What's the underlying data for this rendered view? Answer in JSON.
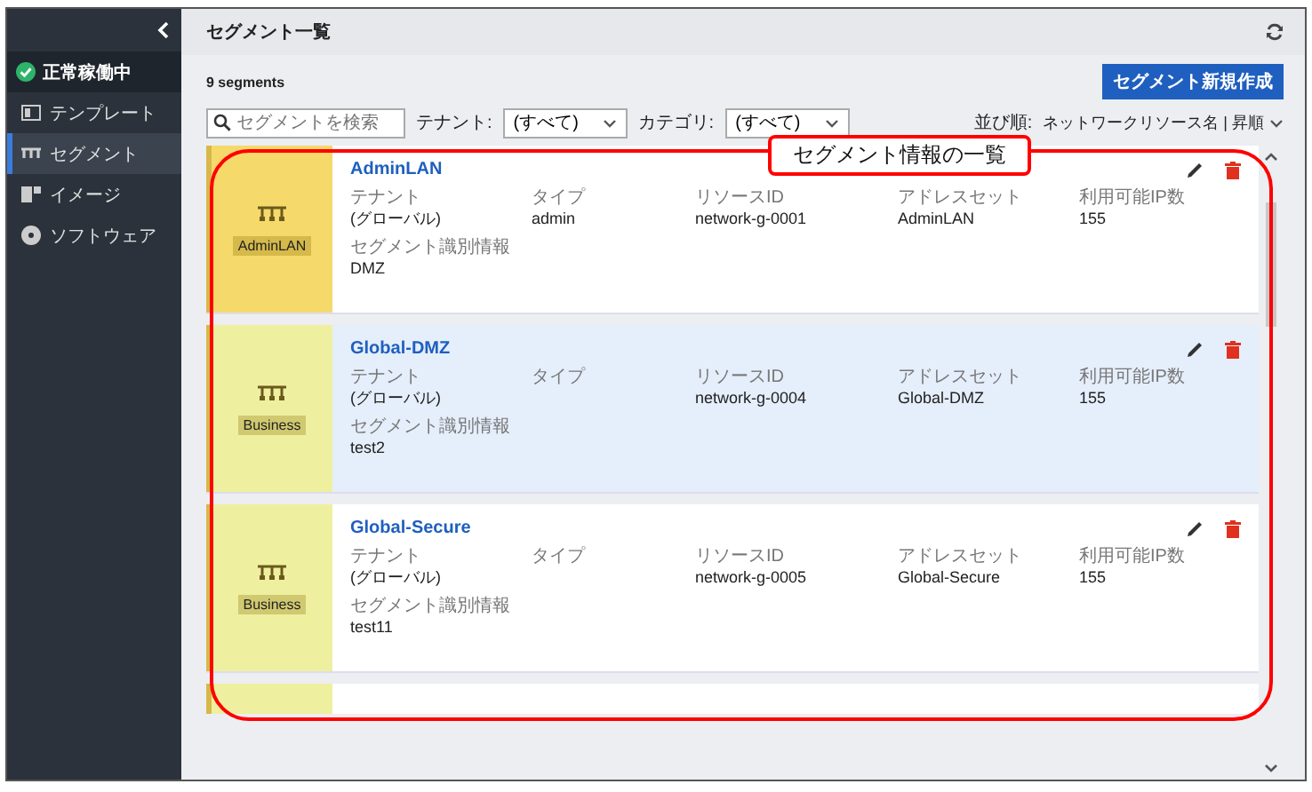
{
  "sidebar": {
    "status": "正常稼働中",
    "items": [
      {
        "label": "テンプレート",
        "selected": false
      },
      {
        "label": "セグメント",
        "selected": true
      },
      {
        "label": "イメージ",
        "selected": false
      },
      {
        "label": "ソフトウェア",
        "selected": false
      }
    ]
  },
  "header": {
    "title": "セグメント一覧"
  },
  "count": "9 segments",
  "create_button": "セグメント新規作成",
  "search": {
    "placeholder": "セグメントを検索"
  },
  "filters": [
    {
      "label": "テナント:",
      "value": "(すべて)"
    },
    {
      "label": "カテゴリ:",
      "value": "(すべて)"
    }
  ],
  "sort": {
    "label": "並び順:",
    "value": "ネットワークリソース名 | 昇順"
  },
  "segments": [
    {
      "name": "AdminLAN",
      "category": "AdminLAN",
      "color": "#f5d96b",
      "highlighted": false,
      "fields": [
        {
          "label": "テナント",
          "value": "(グローバル)"
        },
        {
          "label": "タイプ",
          "value": "admin"
        },
        {
          "label": "リソースID",
          "value": "network-g-0001"
        },
        {
          "label": "アドレスセット",
          "value": "AdminLAN"
        },
        {
          "label": "利用可能IP数",
          "value": "155"
        }
      ],
      "id_label": "セグメント識別情報",
      "id_value": "DMZ"
    },
    {
      "name": "Global-DMZ",
      "category": "Business",
      "color": "#eef0a0",
      "highlighted": true,
      "fields": [
        {
          "label": "テナント",
          "value": "(グローバル)"
        },
        {
          "label": "タイプ"
        },
        {
          "label": "リソースID",
          "value": "network-g-0004"
        },
        {
          "label": "アドレスセット",
          "value": "Global-DMZ"
        },
        {
          "label": "利用可能IP数",
          "value": "155"
        }
      ],
      "id_label": "セグメント識別情報",
      "id_value": "test2"
    },
    {
      "name": "Global-Secure",
      "category": "Business",
      "color": "#eef0a0",
      "highlighted": false,
      "fields": [
        {
          "label": "テナント",
          "value": "(グローバル)"
        },
        {
          "label": "タイプ"
        },
        {
          "label": "リソースID",
          "value": "network-g-0005"
        },
        {
          "label": "アドレスセット",
          "value": "Global-Secure"
        },
        {
          "label": "利用可能IP数",
          "value": "155"
        }
      ],
      "id_label": "セグメント識別情報",
      "id_value": "test11"
    }
  ],
  "annotation": {
    "label": "セグメント情報の一覧"
  }
}
